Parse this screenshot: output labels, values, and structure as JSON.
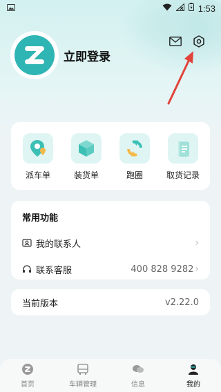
{
  "status_bar": {
    "time": "1:53"
  },
  "profile": {
    "login_text": "立即登录"
  },
  "quick_actions": [
    {
      "label": "派车单",
      "icon": "map-pin-icon"
    },
    {
      "label": "装货单",
      "icon": "box-icon"
    },
    {
      "label": "跑圈",
      "icon": "refresh-icon"
    },
    {
      "label": "取货记录",
      "icon": "document-icon"
    }
  ],
  "common_functions": {
    "title": "常用功能",
    "contacts_label": "我的联系人",
    "service_label": "联系客服",
    "service_phone": "400 828 9282"
  },
  "version": {
    "label": "当前版本",
    "value": "v2.22.0"
  },
  "tabbar": [
    {
      "label": "首页",
      "icon": "home-icon"
    },
    {
      "label": "车辆管理",
      "icon": "bus-icon"
    },
    {
      "label": "信息",
      "icon": "chat-icon"
    },
    {
      "label": "我的",
      "icon": "user-icon"
    }
  ],
  "colors": {
    "accent": "#2fb5b3",
    "arrow": "#e0443c",
    "background": "#eef4f6"
  }
}
